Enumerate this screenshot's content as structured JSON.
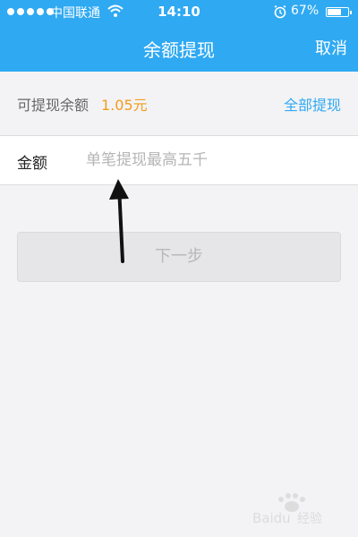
{
  "status_bar": {
    "carrier": "中国联通",
    "time": "14:10",
    "battery_percent": "67%",
    "battery_level": 0.67,
    "wifi_icon": "wifi-icon",
    "alarm_icon": "alarm-icon"
  },
  "header": {
    "title": "余额提现",
    "cancel_label": "取消"
  },
  "balance": {
    "label": "可提现余额",
    "value": "1.05元",
    "withdraw_all_label": "全部提现"
  },
  "amount": {
    "label": "金额",
    "placeholder": "单笔提现最高五千",
    "value": ""
  },
  "next_button": {
    "label": "下一步"
  },
  "colors": {
    "header_bg": "#2fa9f2",
    "balance_value": "#f39c1b",
    "link": "#2fa9f2",
    "page_bg": "#f3f3f5"
  }
}
